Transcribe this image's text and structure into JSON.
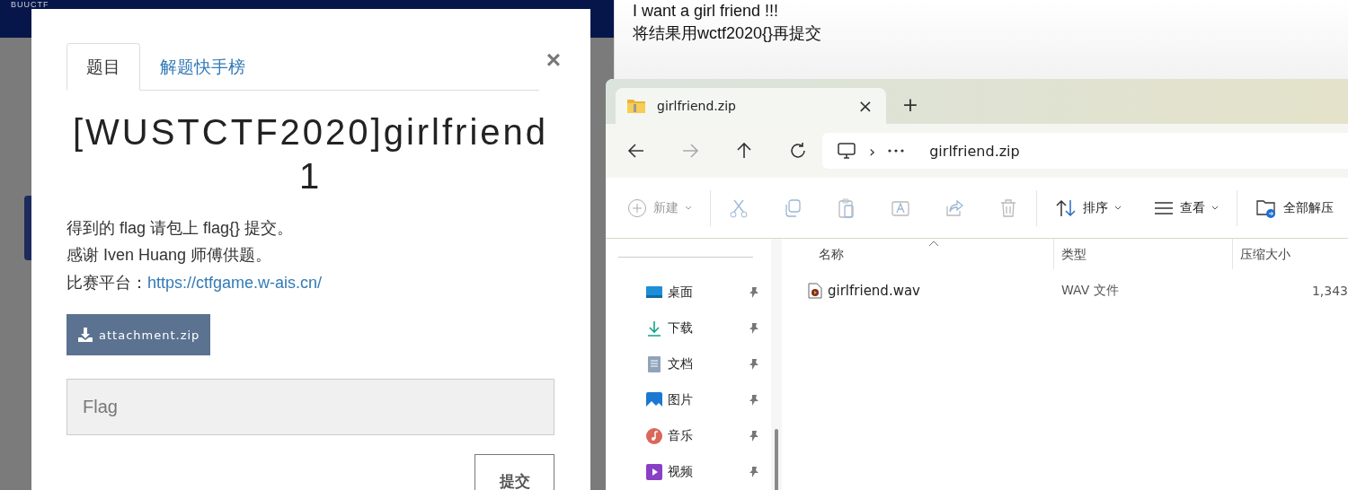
{
  "site_header": {
    "brand": "BUUCTF"
  },
  "modal": {
    "tabs": [
      {
        "label": "题目",
        "selected": true
      },
      {
        "label": "解题快手榜",
        "selected": false
      }
    ],
    "close": "×",
    "title": "[WUSTCTF2020]girlfriend 1",
    "lines": [
      "得到的 flag 请包上 flag{} 提交。",
      "感谢 Iven Huang 师傅供题。"
    ],
    "platform": {
      "label": "比赛平台：",
      "link": "https://ctfgame.w-ais.cn/"
    },
    "attachment": "attachment.zip",
    "flag_field": {
      "placeholder": "Flag"
    },
    "submit": "提交"
  },
  "note": {
    "lines": [
      "I want a girl friend !!!",
      "将结果用wctf2020{}再提交"
    ]
  },
  "explorer": {
    "tab": {
      "title": "girlfriend.zip",
      "close": "×"
    },
    "new_tab": "+",
    "address": {
      "separator": "›",
      "path": "girlfriend.zip"
    },
    "toolbar": {
      "new": "新建",
      "sort": "排序",
      "view": "查看",
      "extract": "全部解压"
    },
    "sidebar": {
      "items": [
        {
          "label": "桌面",
          "pinned": true
        },
        {
          "label": "下载",
          "pinned": true
        },
        {
          "label": "文档",
          "pinned": true
        },
        {
          "label": "图片",
          "pinned": true
        },
        {
          "label": "音乐",
          "pinned": true
        },
        {
          "label": "视频",
          "pinned": true
        }
      ]
    },
    "columns": [
      "名称",
      "类型",
      "压缩大小"
    ],
    "rows": [
      {
        "name": "girlfriend.wav",
        "type": "WAV 文件",
        "size": "1,343"
      }
    ]
  }
}
